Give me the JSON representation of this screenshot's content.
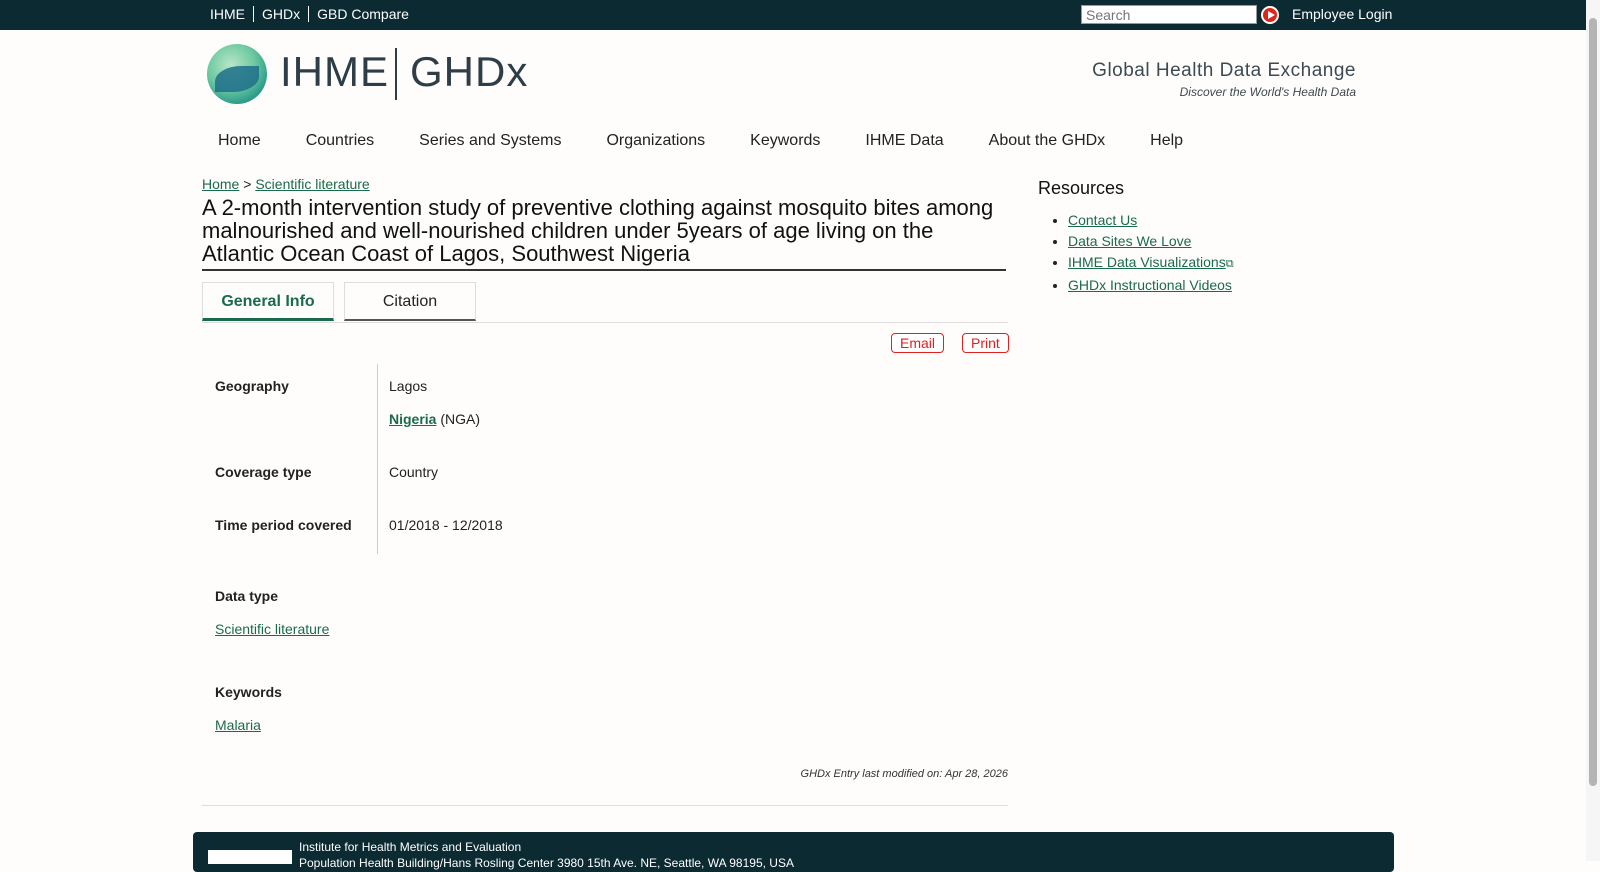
{
  "topbar": {
    "links": [
      "IHME",
      "GHDx",
      "GBD Compare"
    ],
    "search_placeholder": "Search",
    "login": "Employee Login"
  },
  "header": {
    "logo_ihme": "IHME",
    "logo_ghdx": "GHDx",
    "tagline_title": "Global Health Data Exchange",
    "tagline_sub": "Discover the World's Health Data"
  },
  "nav": [
    "Home",
    "Countries",
    "Series and Systems",
    "Organizations",
    "Keywords",
    "IHME Data",
    "About the GHDx",
    "Help"
  ],
  "breadcrumb": {
    "home": "Home",
    "sep": ">",
    "section": "Scientific literature"
  },
  "title": "A 2-month intervention study of preventive clothing against mosquito bites among malnourished and well-nourished children under 5years of age living on the Atlantic Ocean Coast of Lagos, Southwest Nigeria",
  "tabs": {
    "general": "General Info",
    "citation": "Citation"
  },
  "actions": {
    "email": "Email",
    "print": "Print"
  },
  "info": {
    "geography_label": "Geography",
    "geography_value": "Lagos",
    "country_link": "Nigeria",
    "country_code": "(NGA)",
    "coverage_label": "Coverage type",
    "coverage_value": "Country",
    "time_label": "Time period covered",
    "time_value": "01/2018 - 12/2018",
    "datatype_label": "Data type",
    "datatype_value": "Scientific literature",
    "keywords_label": "Keywords",
    "keywords_value": "Malaria"
  },
  "modified": "GHDx Entry last modified on: Apr 28, 2026",
  "resources": {
    "title": "Resources",
    "items": [
      "Contact Us",
      "Data Sites We Love",
      "IHME Data Visualizations",
      "GHDx Instructional Videos"
    ]
  },
  "footer": {
    "line1": "Institute for Health Metrics and Evaluation",
    "line2": "Population Health Building/Hans Rosling Center 3980 15th Ave. NE, Seattle, WA 98195, USA"
  }
}
